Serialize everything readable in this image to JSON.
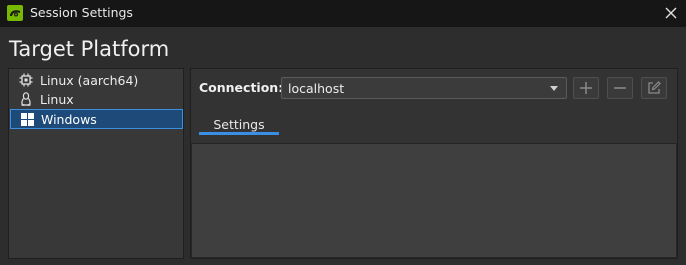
{
  "window": {
    "title": "Session Settings",
    "app_icon": "nvidia-nsight-icon",
    "close_icon": "close-icon"
  },
  "heading": "Target Platform",
  "platforms": [
    {
      "label": "Linux (aarch64)",
      "icon": "chip-icon",
      "selected": false
    },
    {
      "label": "Linux",
      "icon": "penguin-icon",
      "selected": false
    },
    {
      "label": "Windows",
      "icon": "windows-icon",
      "selected": true
    }
  ],
  "connection": {
    "label": "Connection:",
    "value": "localhost",
    "buttons": [
      {
        "name": "add-connection-button",
        "icon": "plus-icon"
      },
      {
        "name": "remove-connection-button",
        "icon": "minus-icon"
      },
      {
        "name": "edit-connection-button",
        "icon": "edit-icon"
      }
    ]
  },
  "tabs": [
    {
      "label": "Settings",
      "active": true
    }
  ],
  "colors": {
    "accent": "#3a8ee6",
    "selection_bg": "#1e4a7a",
    "titlebar_bg": "#161616",
    "window_bg": "#2d2d2d"
  }
}
